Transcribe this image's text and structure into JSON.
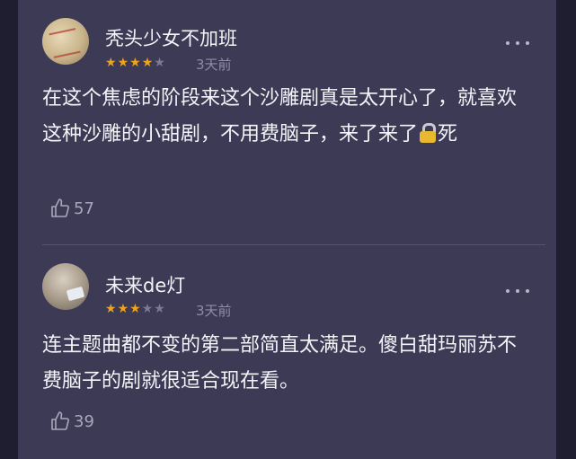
{
  "colors": {
    "background": "#3c3a55",
    "star_filled": "#f0a21b",
    "star_empty": "#7d7b92",
    "muted_text": "#8f8da6"
  },
  "reviews": [
    {
      "username": "秃头少女不加班",
      "rating": 4,
      "max_rating": 5,
      "time": "3天前",
      "text_before_emoji": "在这个焦虑的阶段来这个沙雕剧真是太开心了，就喜欢这种沙雕的小甜剧，不用费脑子，来了来了",
      "emoji_icon": "lock-icon",
      "text_after_emoji": "死",
      "likes": "57"
    },
    {
      "username": "未来de灯",
      "rating": 3,
      "max_rating": 5,
      "time": "3天前",
      "text": "连主题曲都不变的第二部简直太满足。傻白甜玛丽苏不费脑子的剧就很适合现在看。",
      "likes": "39"
    }
  ]
}
